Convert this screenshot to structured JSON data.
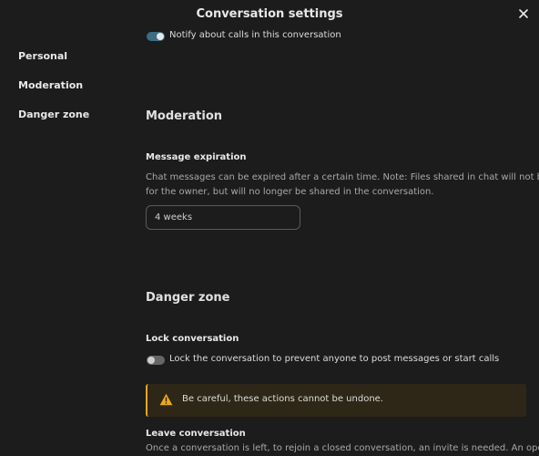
{
  "dialog": {
    "title": "Conversation settings",
    "close_icon": "close-icon"
  },
  "nav": {
    "items": [
      {
        "label": "Personal"
      },
      {
        "label": "Moderation"
      },
      {
        "label": "Danger zone"
      }
    ]
  },
  "notifications": {
    "calls_toggle_label": "Notify about calls in this conversation",
    "calls_toggle_on": true
  },
  "moderation": {
    "heading": "Moderation",
    "expiration": {
      "title": "Message expiration",
      "description_lines": [
        "Chat messages can be expired after a certain time. Note: Files shared in chat will not be deleted",
        "for the owner, but will no longer be shared in the conversation."
      ],
      "selected_value": "4 weeks"
    }
  },
  "danger_zone": {
    "heading": "Danger zone",
    "lock": {
      "title": "Lock conversation",
      "toggle_label": "Lock the conversation to prevent anyone to post messages or start calls",
      "toggle_on": false
    },
    "warning": {
      "icon": "warning-icon",
      "text": "Be careful, these actions cannot be undone.",
      "accent_color": "#e9a81f"
    },
    "leave": {
      "title": "Leave conversation",
      "description": "Once a conversation is left, to rejoin a closed conversation, an invite is needed. An open"
    }
  },
  "colors": {
    "background": "#1c1c1c",
    "toggle_on": "#3c6c86",
    "warning_bg": "#2e2717"
  }
}
